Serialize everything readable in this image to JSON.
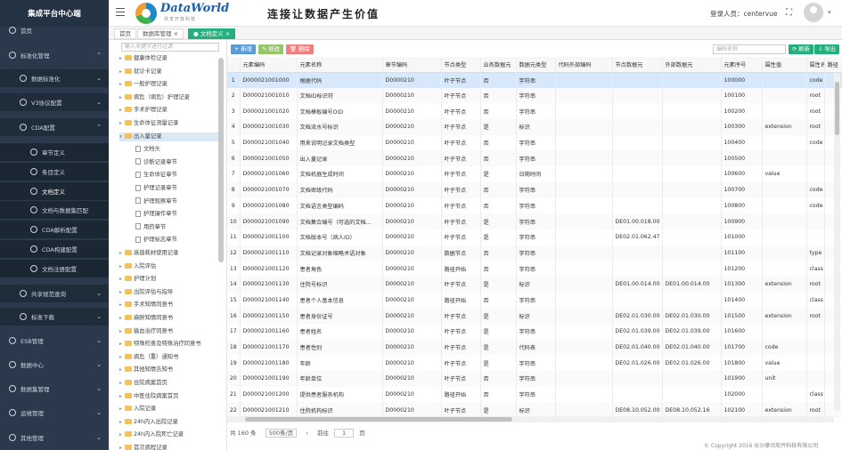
{
  "app": {
    "title": "集成平台中心端"
  },
  "sidebar": {
    "items": [
      {
        "label": "首页",
        "level": 1,
        "icon": "home-icon"
      },
      {
        "label": "标准化管理",
        "level": 1,
        "icon": "folder-icon",
        "chevron": "⌃"
      },
      {
        "label": "数据标准化",
        "level": 2,
        "icon": "gear-icon",
        "chevron": "⌄"
      },
      {
        "label": "V3协议配置",
        "level": 2,
        "icon": "gear-icon",
        "chevron": "⌄"
      },
      {
        "label": "CDA配置",
        "level": 2,
        "icon": "gear-icon",
        "chevron": "⌃"
      },
      {
        "label": "章节定义",
        "level": 3,
        "icon": "gear-icon"
      },
      {
        "label": "条目定义",
        "level": 3,
        "icon": "gear-icon"
      },
      {
        "label": "文档定义",
        "level": 3,
        "icon": "gear-icon",
        "active": true
      },
      {
        "label": "文档与数据集匹配",
        "level": 3,
        "icon": "gear-icon"
      },
      {
        "label": "CDA解析配置",
        "level": 3,
        "icon": "gear-icon"
      },
      {
        "label": "CDA构建配置",
        "level": 3,
        "icon": "gear-icon"
      },
      {
        "label": "文档注册配置",
        "level": 3,
        "icon": "gear-icon"
      },
      {
        "label": "共享规范查询",
        "level": 2,
        "icon": "gear-icon",
        "chevron": "⌄"
      },
      {
        "label": "标准下载",
        "level": 2,
        "icon": "gear-icon",
        "chevron": "⌄"
      },
      {
        "label": "ESB管理",
        "level": 1,
        "icon": "gear-icon",
        "chevron": "⌄"
      },
      {
        "label": "数据中心",
        "level": 1,
        "icon": "gear-icon",
        "chevron": "⌄"
      },
      {
        "label": "数据集管理",
        "level": 1,
        "icon": "gear-icon",
        "chevron": "⌄"
      },
      {
        "label": "运维管理",
        "level": 1,
        "icon": "gear-icon",
        "chevron": "⌄"
      },
      {
        "label": "其他管理",
        "level": 1,
        "icon": "gear-icon",
        "chevron": "⌄"
      }
    ]
  },
  "header": {
    "logo_text": "DataWorld",
    "logo_sub": "共享开放科技",
    "slogan": "连接让数据产生价值",
    "user_label": "登录人员：centervue"
  },
  "tabs": [
    {
      "label": "首页"
    },
    {
      "label": "数据库管理 ×"
    },
    {
      "label": "● 文档定义 ×",
      "active": true
    }
  ],
  "tree": {
    "search_placeholder": "输入关键字进行过滤",
    "nodes": [
      {
        "label": "健康体检记录",
        "type": "folder",
        "depth": 1
      },
      {
        "label": "就诊卡记录",
        "type": "folder",
        "depth": 1
      },
      {
        "label": "一般护理记录",
        "type": "folder",
        "depth": 1
      },
      {
        "label": "病危（病危）护理记录",
        "type": "folder",
        "depth": 1
      },
      {
        "label": "手术护理记录",
        "type": "folder",
        "depth": 1
      },
      {
        "label": "生命体征测量记录",
        "type": "folder",
        "depth": 1
      },
      {
        "label": "出入量记录",
        "type": "folder",
        "depth": 1,
        "open": true,
        "sel": true
      },
      {
        "label": "文档头",
        "type": "page",
        "depth": 2
      },
      {
        "label": "诊断记录章节",
        "type": "page",
        "depth": 2
      },
      {
        "label": "生命体征章节",
        "type": "page",
        "depth": 2
      },
      {
        "label": "护理记录章节",
        "type": "page",
        "depth": 2
      },
      {
        "label": "护理观察章节",
        "type": "page",
        "depth": 2
      },
      {
        "label": "护理操作章节",
        "type": "page",
        "depth": 2
      },
      {
        "label": "用药章节",
        "type": "page",
        "depth": 2
      },
      {
        "label": "护理标志章节",
        "type": "page",
        "depth": 2
      },
      {
        "label": "高值耗材使用记录",
        "type": "folder",
        "depth": 1
      },
      {
        "label": "入院评估",
        "type": "folder",
        "depth": 1
      },
      {
        "label": "护理计划",
        "type": "folder",
        "depth": 1
      },
      {
        "label": "出院评估与指导",
        "type": "folder",
        "depth": 1
      },
      {
        "label": "手术知情同意书",
        "type": "folder",
        "depth": 1
      },
      {
        "label": "麻醉知情同意书",
        "type": "folder",
        "depth": 1
      },
      {
        "label": "输血治疗同意书",
        "type": "folder",
        "depth": 1
      },
      {
        "label": "特殊检查及特殊治疗同意书",
        "type": "folder",
        "depth": 1
      },
      {
        "label": "病危（重）通知书",
        "type": "folder",
        "depth": 1
      },
      {
        "label": "其他知情告知书",
        "type": "folder",
        "depth": 1
      },
      {
        "label": "住院病案首页",
        "type": "folder",
        "depth": 1
      },
      {
        "label": "中医住院病案首页",
        "type": "folder",
        "depth": 1
      },
      {
        "label": "入院记录",
        "type": "folder",
        "depth": 1
      },
      {
        "label": "24h内入出院记录",
        "type": "folder",
        "depth": 1
      },
      {
        "label": "24h内入院死亡记录",
        "type": "folder",
        "depth": 1
      },
      {
        "label": "首次病程记录",
        "type": "folder",
        "depth": 1
      }
    ]
  },
  "toolbar": {
    "add": "+ 新增",
    "edit": "✎ 修改",
    "delete": "🗑 删除",
    "search_placeholder": "编码名称",
    "refresh": "⟳ 刷新",
    "export": "⇩ 导出"
  },
  "table": {
    "columns": [
      "",
      "元素编码",
      "元素名称",
      "章节编码",
      "节点类型",
      "业务数据元",
      "数据元类型",
      "代码外部编码",
      "节点数据元",
      "外部数据元",
      "元素序号",
      "属性值",
      "属性名称",
      "路径"
    ],
    "rows": [
      [
        "1",
        "D000021001000",
        "根据代码",
        "D0000210",
        "叶子节点",
        "否",
        "字符串",
        "",
        "",
        "",
        "100000",
        "",
        "code",
        ""
      ],
      [
        "2",
        "D000021001010",
        "文档ID标识符",
        "D0000210",
        "叶子节点",
        "否",
        "字符串",
        "",
        "",
        "",
        "100100",
        "",
        "root",
        ""
      ],
      [
        "3",
        "D000021001020",
        "文档模板编号OID",
        "D0000210",
        "叶子节点",
        "否",
        "字符串",
        "",
        "",
        "",
        "100200",
        "",
        "root",
        ""
      ],
      [
        "4",
        "D000021001030",
        "文档流水号标识",
        "D0000210",
        "叶子节点",
        "是",
        "标识",
        "",
        "",
        "",
        "100300",
        "extension",
        "root",
        ""
      ],
      [
        "5",
        "D000021001040",
        "用来说明记录文档类型",
        "D0000210",
        "叶子节点",
        "否",
        "字符串",
        "",
        "",
        "",
        "100400",
        "",
        "code",
        ""
      ],
      [
        "6",
        "D000021001050",
        "出入量记录",
        "D0000210",
        "叶子节点",
        "否",
        "字符串",
        "",
        "",
        "",
        "100500",
        "",
        "",
        ""
      ],
      [
        "7",
        "D000021001060",
        "文档机器生成时间",
        "D0000210",
        "叶子节点",
        "是",
        "日期时间",
        "",
        "",
        "",
        "100600",
        "value",
        "",
        ""
      ],
      [
        "8",
        "D000021001070",
        "文档密级代码",
        "D0000210",
        "叶子节点",
        "否",
        "字符串",
        "",
        "",
        "",
        "100700",
        "",
        "code",
        ""
      ],
      [
        "9",
        "D000021001080",
        "文档语言类型编码",
        "D0000210",
        "叶子节点",
        "否",
        "字符串",
        "",
        "",
        "",
        "100800",
        "",
        "code",
        ""
      ],
      [
        "10",
        "D000021001090",
        "文档集合编号（可选的文档...",
        "D0000210",
        "叶子节点",
        "是",
        "字符串",
        "",
        "DE01.00.018.00",
        "",
        "100900",
        "",
        "",
        ""
      ],
      [
        "11",
        "D000021001100",
        "文档版本号（病人ID）",
        "D0000210",
        "叶子节点",
        "是",
        "字符串",
        "",
        "DE02.01.062.47",
        "",
        "101000",
        "",
        "",
        ""
      ],
      [
        "12",
        "D000021001110",
        "文档记录对象缩略术语对象",
        "D0000210",
        "数据节点",
        "否",
        "字符串",
        "",
        "",
        "",
        "101100",
        "",
        "type",
        ""
      ],
      [
        "13",
        "D000021001120",
        "患者角色",
        "D0000210",
        "路径开始",
        "否",
        "字符串",
        "",
        "",
        "",
        "101200",
        "",
        "class",
        ""
      ],
      [
        "14",
        "D000021001130",
        "住院号标识",
        "D0000210",
        "叶子节点",
        "是",
        "标识",
        "",
        "DE01.00.014.00",
        "DE01.00.014.00",
        "101300",
        "extension",
        "root",
        ""
      ],
      [
        "15",
        "D000021001140",
        "患者个人基本信息",
        "D0000210",
        "路径开始",
        "否",
        "字符串",
        "",
        "",
        "",
        "101400",
        "",
        "class",
        ""
      ],
      [
        "16",
        "D000021001150",
        "患者身份证号",
        "D0000210",
        "叶子节点",
        "是",
        "标识",
        "",
        "DE02.01.030.00",
        "DE02.01.030.00",
        "101500",
        "extension",
        "root",
        ""
      ],
      [
        "17",
        "D000021001160",
        "患者姓名",
        "D0000210",
        "叶子节点",
        "是",
        "字符串",
        "",
        "DE02.01.039.00",
        "DE02.01.039.00",
        "101600",
        "",
        "",
        ""
      ],
      [
        "18",
        "D000021001170",
        "患者性别",
        "D0000210",
        "叶子节点",
        "是",
        "代码表",
        "",
        "DE02.01.040.00",
        "DE02.01.040.00",
        "101700",
        "code",
        "",
        ""
      ],
      [
        "19",
        "D000021001180",
        "年龄",
        "D0000210",
        "叶子节点",
        "是",
        "字符串",
        "",
        "DE02.01.026.00",
        "DE02.01.026.00",
        "101800",
        "value",
        "",
        ""
      ],
      [
        "20",
        "D000021001190",
        "年龄单位",
        "D0000210",
        "叶子节点",
        "否",
        "字符串",
        "",
        "",
        "",
        "101900",
        "unit",
        "",
        ""
      ],
      [
        "21",
        "D000021001200",
        "提供患者服务机构",
        "D0000210",
        "路径开始",
        "否",
        "字符串",
        "",
        "",
        "",
        "102000",
        "",
        "class",
        ""
      ],
      [
        "22",
        "D000021001210",
        "住院机构标识",
        "D0000210",
        "叶子节点",
        "是",
        "标识",
        "",
        "DE08.10.052.00",
        "DE08.10.052.16",
        "102100",
        "extension",
        "root",
        ""
      ]
    ]
  },
  "pager": {
    "total": "共 160 条",
    "page_size": "500条/页",
    "prev": "前往",
    "page": "1",
    "unit": "页"
  },
  "footer": {
    "copyright": "© Copyright 2016 长沙摩讯软件科技有限公司"
  },
  "colors": {
    "sidebar": "#2a3a4c",
    "accent": "#23b07d",
    "add": "#5b9bd5",
    "edit": "#97c76b",
    "delete": "#f08080"
  }
}
